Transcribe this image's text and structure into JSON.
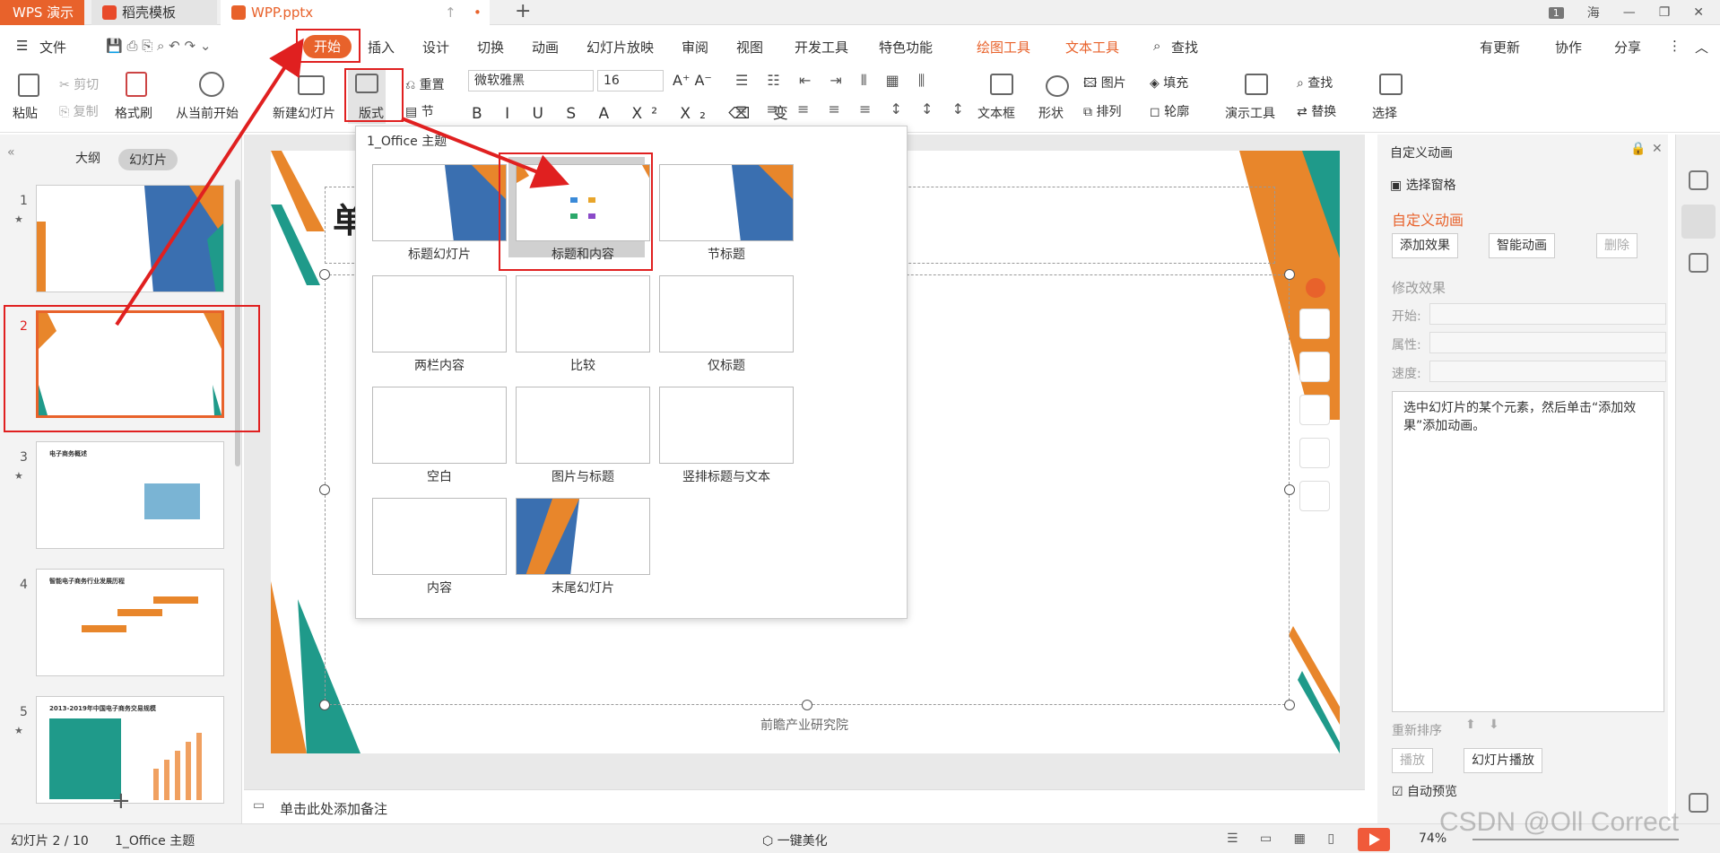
{
  "titlebar": {
    "app_tab": "WPS 演示",
    "tabs": [
      "稻壳模板",
      "WPP.pptx"
    ],
    "page_badge": "1",
    "user": "海"
  },
  "menu": {
    "file": "文件",
    "items": [
      "开始",
      "插入",
      "设计",
      "切换",
      "动画",
      "幻灯片放映",
      "审阅",
      "视图",
      "开发工具",
      "特色功能",
      "绘图工具",
      "文本工具",
      "查找"
    ],
    "right": [
      "有更新",
      "协作",
      "分享"
    ]
  },
  "ribbon": {
    "paste": "粘贴",
    "cut": "剪切",
    "copy": "复制",
    "format_painter": "格式刷",
    "from_current": "从当前开始",
    "new_slide": "新建幻灯片",
    "layout": "版式",
    "reset": "重置",
    "section": "节",
    "font_name": "微软雅黑",
    "font_size": "16",
    "textbox": "文本框",
    "shape": "形状",
    "picture": "图片",
    "fill": "填充",
    "arrange": "排列",
    "outline": "轮廓",
    "present_tools": "演示工具",
    "find": "查找",
    "replace": "替换",
    "select": "选择"
  },
  "left_panel": {
    "tab_outline": "大纲",
    "tab_slides": "幻灯片",
    "slides": [
      {
        "num": "1",
        "star": "★"
      },
      {
        "num": "2",
        "star": ""
      },
      {
        "num": "3",
        "star": "★",
        "title": "电子商务概述"
      },
      {
        "num": "4",
        "star": "",
        "title": "智能电子商务行业发展历程"
      },
      {
        "num": "5",
        "star": "★",
        "title": "2013-2019年中国电子商务交易规模"
      }
    ]
  },
  "dropdown": {
    "header": "1_Office 主题",
    "layouts": [
      "标题幻灯片",
      "标题和内容",
      "节标题",
      "两栏内容",
      "比较",
      "仅标题",
      "空白",
      "图片与标题",
      "竖排标题与文本",
      "内容",
      "末尾幻灯片"
    ]
  },
  "slide": {
    "title_partial": "单",
    "footer": "前瞻产业研究院"
  },
  "right_panel": {
    "header": "自定义动画",
    "select_pane": "选择窗格",
    "title": "自定义动画",
    "add_effect": "添加效果",
    "smart_anim": "智能动画",
    "delete": "删除",
    "modify_effect": "修改效果",
    "start_label": "开始:",
    "property_label": "属性:",
    "speed_label": "速度:",
    "hint": "选中幻灯片的某个元素，然后单击“添加效果”添加动画。",
    "reorder": "重新排序",
    "play": "播放",
    "slideshow": "幻灯片播放",
    "auto_preview": "自动预览"
  },
  "notes": {
    "placeholder": "单击此处添加备注"
  },
  "status": {
    "slide_pos": "幻灯片 2 / 10",
    "theme": "1_Office 主题",
    "beautify": "一键美化",
    "zoom": "74%"
  },
  "watermark": "CSDN @Oll Correct",
  "colors": {
    "accent": "#e8622b",
    "teal": "#1f9a8a",
    "highlight": "#e02020"
  }
}
